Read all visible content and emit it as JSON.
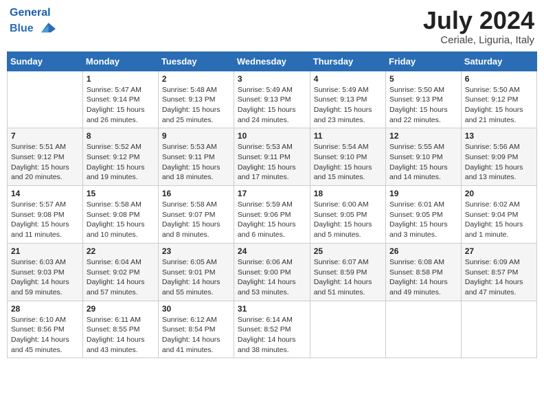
{
  "header": {
    "logo_line1": "General",
    "logo_line2": "Blue",
    "month_year": "July 2024",
    "location": "Ceriale, Liguria, Italy"
  },
  "weekdays": [
    "Sunday",
    "Monday",
    "Tuesday",
    "Wednesday",
    "Thursday",
    "Friday",
    "Saturday"
  ],
  "weeks": [
    [
      {
        "day": "",
        "info": ""
      },
      {
        "day": "1",
        "info": "Sunrise: 5:47 AM\nSunset: 9:14 PM\nDaylight: 15 hours\nand 26 minutes."
      },
      {
        "day": "2",
        "info": "Sunrise: 5:48 AM\nSunset: 9:13 PM\nDaylight: 15 hours\nand 25 minutes."
      },
      {
        "day": "3",
        "info": "Sunrise: 5:49 AM\nSunset: 9:13 PM\nDaylight: 15 hours\nand 24 minutes."
      },
      {
        "day": "4",
        "info": "Sunrise: 5:49 AM\nSunset: 9:13 PM\nDaylight: 15 hours\nand 23 minutes."
      },
      {
        "day": "5",
        "info": "Sunrise: 5:50 AM\nSunset: 9:13 PM\nDaylight: 15 hours\nand 22 minutes."
      },
      {
        "day": "6",
        "info": "Sunrise: 5:50 AM\nSunset: 9:12 PM\nDaylight: 15 hours\nand 21 minutes."
      }
    ],
    [
      {
        "day": "7",
        "info": "Sunrise: 5:51 AM\nSunset: 9:12 PM\nDaylight: 15 hours\nand 20 minutes."
      },
      {
        "day": "8",
        "info": "Sunrise: 5:52 AM\nSunset: 9:12 PM\nDaylight: 15 hours\nand 19 minutes."
      },
      {
        "day": "9",
        "info": "Sunrise: 5:53 AM\nSunset: 9:11 PM\nDaylight: 15 hours\nand 18 minutes."
      },
      {
        "day": "10",
        "info": "Sunrise: 5:53 AM\nSunset: 9:11 PM\nDaylight: 15 hours\nand 17 minutes."
      },
      {
        "day": "11",
        "info": "Sunrise: 5:54 AM\nSunset: 9:10 PM\nDaylight: 15 hours\nand 15 minutes."
      },
      {
        "day": "12",
        "info": "Sunrise: 5:55 AM\nSunset: 9:10 PM\nDaylight: 15 hours\nand 14 minutes."
      },
      {
        "day": "13",
        "info": "Sunrise: 5:56 AM\nSunset: 9:09 PM\nDaylight: 15 hours\nand 13 minutes."
      }
    ],
    [
      {
        "day": "14",
        "info": "Sunrise: 5:57 AM\nSunset: 9:08 PM\nDaylight: 15 hours\nand 11 minutes."
      },
      {
        "day": "15",
        "info": "Sunrise: 5:58 AM\nSunset: 9:08 PM\nDaylight: 15 hours\nand 10 minutes."
      },
      {
        "day": "16",
        "info": "Sunrise: 5:58 AM\nSunset: 9:07 PM\nDaylight: 15 hours\nand 8 minutes."
      },
      {
        "day": "17",
        "info": "Sunrise: 5:59 AM\nSunset: 9:06 PM\nDaylight: 15 hours\nand 6 minutes."
      },
      {
        "day": "18",
        "info": "Sunrise: 6:00 AM\nSunset: 9:05 PM\nDaylight: 15 hours\nand 5 minutes."
      },
      {
        "day": "19",
        "info": "Sunrise: 6:01 AM\nSunset: 9:05 PM\nDaylight: 15 hours\nand 3 minutes."
      },
      {
        "day": "20",
        "info": "Sunrise: 6:02 AM\nSunset: 9:04 PM\nDaylight: 15 hours\nand 1 minute."
      }
    ],
    [
      {
        "day": "21",
        "info": "Sunrise: 6:03 AM\nSunset: 9:03 PM\nDaylight: 14 hours\nand 59 minutes."
      },
      {
        "day": "22",
        "info": "Sunrise: 6:04 AM\nSunset: 9:02 PM\nDaylight: 14 hours\nand 57 minutes."
      },
      {
        "day": "23",
        "info": "Sunrise: 6:05 AM\nSunset: 9:01 PM\nDaylight: 14 hours\nand 55 minutes."
      },
      {
        "day": "24",
        "info": "Sunrise: 6:06 AM\nSunset: 9:00 PM\nDaylight: 14 hours\nand 53 minutes."
      },
      {
        "day": "25",
        "info": "Sunrise: 6:07 AM\nSunset: 8:59 PM\nDaylight: 14 hours\nand 51 minutes."
      },
      {
        "day": "26",
        "info": "Sunrise: 6:08 AM\nSunset: 8:58 PM\nDaylight: 14 hours\nand 49 minutes."
      },
      {
        "day": "27",
        "info": "Sunrise: 6:09 AM\nSunset: 8:57 PM\nDaylight: 14 hours\nand 47 minutes."
      }
    ],
    [
      {
        "day": "28",
        "info": "Sunrise: 6:10 AM\nSunset: 8:56 PM\nDaylight: 14 hours\nand 45 minutes."
      },
      {
        "day": "29",
        "info": "Sunrise: 6:11 AM\nSunset: 8:55 PM\nDaylight: 14 hours\nand 43 minutes."
      },
      {
        "day": "30",
        "info": "Sunrise: 6:12 AM\nSunset: 8:54 PM\nDaylight: 14 hours\nand 41 minutes."
      },
      {
        "day": "31",
        "info": "Sunrise: 6:14 AM\nSunset: 8:52 PM\nDaylight: 14 hours\nand 38 minutes."
      },
      {
        "day": "",
        "info": ""
      },
      {
        "day": "",
        "info": ""
      },
      {
        "day": "",
        "info": ""
      }
    ]
  ]
}
